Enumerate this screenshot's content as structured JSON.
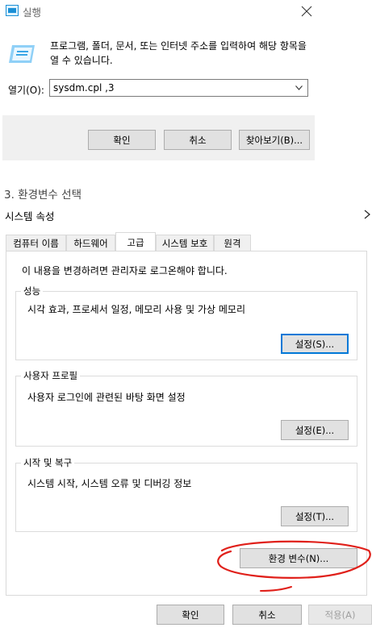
{
  "run_dialog": {
    "title": "실행",
    "description": "프로그램, 폴더, 문서, 또는 인터넷 주소를 입력하여 해당 항목을 열 수 있습니다.",
    "open_label": "열기(O):",
    "input_value": "sysdm.cpl ,3",
    "buttons": {
      "ok": "확인",
      "cancel": "취소",
      "browse": "찾아보기(B)..."
    }
  },
  "step_heading": "3. 환경변수 선택",
  "sysprops": {
    "title": "시스템 속성",
    "tabs": [
      "컴퓨터 이름",
      "하드웨어",
      "고급",
      "시스템 보호",
      "원격"
    ],
    "active_tab_index": 2,
    "admin_note": "이 내용을 변경하려면 관리자로 로그온해야 합니다.",
    "groups": [
      {
        "title": "성능",
        "desc": "시각 효과, 프로세서 일정, 메모리 사용 및 가상 메모리",
        "button": "설정(S)..."
      },
      {
        "title": "사용자 프로필",
        "desc": "사용자 로그인에 관련된 바탕 화면 설정",
        "button": "설정(E)..."
      },
      {
        "title": "시작 및 복구",
        "desc": "시스템 시작, 시스템 오류 및 디버깅 정보",
        "button": "설정(T)..."
      }
    ],
    "env_button": "환경 변수(N)...",
    "footer": {
      "ok": "확인",
      "cancel": "취소",
      "apply": "적용(A)"
    }
  },
  "colors": {
    "annotation": "#e0201a",
    "focus": "#0078d7"
  },
  "icons": [
    "run-app-icon",
    "run-large-icon",
    "close-icon",
    "dropdown-arrow-icon",
    "chevron-right-icon"
  ]
}
